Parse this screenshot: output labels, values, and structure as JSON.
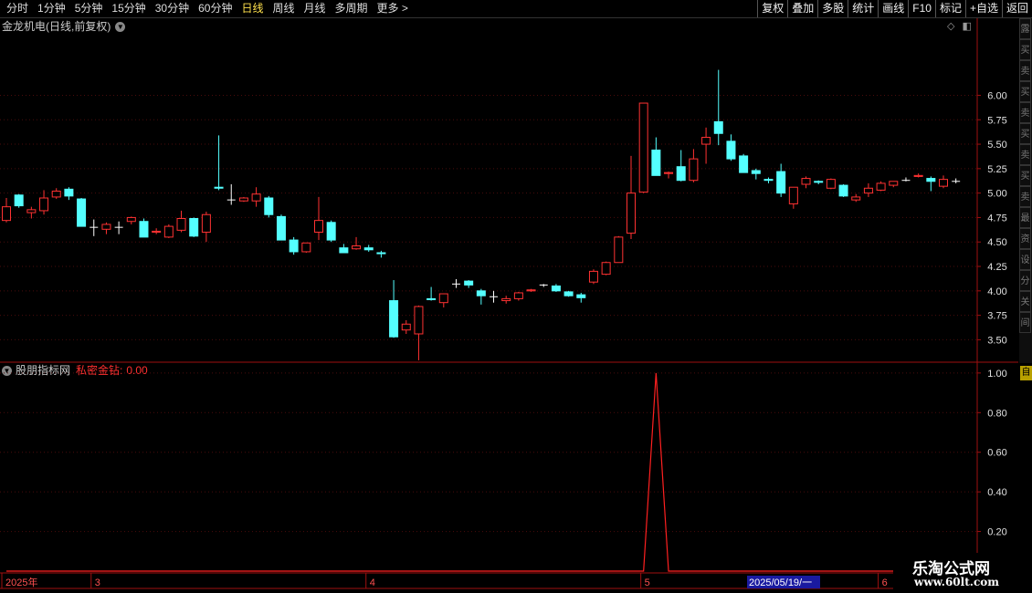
{
  "toolbar": {
    "periods": [
      "分时",
      "1分钟",
      "5分钟",
      "15分钟",
      "30分钟",
      "60分钟",
      "日线",
      "周线",
      "月线",
      "多周期",
      "更多 >"
    ],
    "active_period": "日线",
    "actions": [
      "复权",
      "叠加",
      "多股",
      "统计",
      "画线",
      "F10",
      "标记",
      "+自选",
      "返回"
    ]
  },
  "main_title": "金龙机电(日线,前复权)",
  "indicator": {
    "source": "股朋指标网",
    "name": "私密金钻:",
    "value": "0.00"
  },
  "sidebar_tabs": [
    "露",
    "买",
    "卖",
    "买",
    "卖",
    "买",
    "卖",
    "买",
    "卖",
    "最",
    "资",
    "设",
    "分",
    "关",
    "间"
  ],
  "sidebar_tag": "自",
  "logo": {
    "cn": "乐淘公式网",
    "en": "www.60lt.com"
  },
  "colors": {
    "up": "#ff3232",
    "down": "#54ffff",
    "flat": "#ffffff",
    "indicator_line": "#ff2020",
    "axis": "#a01010",
    "active": "#ffe14d"
  },
  "x_axis": {
    "labels": [
      "2025年",
      "3",
      "4",
      "5",
      "6"
    ],
    "cursor_label": "2025/05/19/一"
  },
  "chart_data": [
    {
      "type": "candlestick",
      "title": "金龙机电(日线,前复权)",
      "ylim": [
        3.28,
        6.62
      ],
      "yticks": [
        3.5,
        3.75,
        4.0,
        4.25,
        4.5,
        4.75,
        5.0,
        5.25,
        5.5,
        5.75,
        6.0
      ],
      "ohlc": [
        [
          4.72,
          4.95,
          4.7,
          4.86
        ],
        [
          4.98,
          4.99,
          4.85,
          4.87
        ],
        [
          4.8,
          4.86,
          4.74,
          4.83
        ],
        [
          4.82,
          5.03,
          4.78,
          4.95
        ],
        [
          4.96,
          5.05,
          4.94,
          5.02
        ],
        [
          5.04,
          5.06,
          4.93,
          4.97
        ],
        [
          4.94,
          4.95,
          4.67,
          4.66
        ],
        [
          4.65,
          4.73,
          4.56,
          4.65
        ],
        [
          4.63,
          4.7,
          4.58,
          4.68
        ],
        [
          4.65,
          4.71,
          4.58,
          4.65
        ],
        [
          4.71,
          4.76,
          4.68,
          4.75
        ],
        [
          4.71,
          4.74,
          4.55,
          4.55
        ],
        [
          4.6,
          4.64,
          4.58,
          4.61
        ],
        [
          4.55,
          4.68,
          4.54,
          4.66
        ],
        [
          4.62,
          4.82,
          4.6,
          4.74
        ],
        [
          4.74,
          4.75,
          4.55,
          4.56
        ],
        [
          4.6,
          4.81,
          4.5,
          4.78
        ],
        [
          5.06,
          5.59,
          5.03,
          5.05
        ],
        [
          4.93,
          5.09,
          4.88,
          4.93
        ],
        [
          4.92,
          4.96,
          4.91,
          4.95
        ],
        [
          4.92,
          5.06,
          4.86,
          4.99
        ],
        [
          4.95,
          4.97,
          4.75,
          4.78
        ],
        [
          4.76,
          4.78,
          4.52,
          4.52
        ],
        [
          4.52,
          4.55,
          4.37,
          4.4
        ],
        [
          4.4,
          4.49,
          4.39,
          4.49
        ],
        [
          4.6,
          4.96,
          4.52,
          4.72
        ],
        [
          4.7,
          4.72,
          4.5,
          4.52
        ],
        [
          4.44,
          4.48,
          4.39,
          4.39
        ],
        [
          4.43,
          4.55,
          4.42,
          4.46
        ],
        [
          4.44,
          4.47,
          4.4,
          4.42
        ],
        [
          4.39,
          4.41,
          4.34,
          4.38
        ],
        [
          3.9,
          4.11,
          3.52,
          3.53
        ],
        [
          3.6,
          3.7,
          3.56,
          3.66
        ],
        [
          3.56,
          3.85,
          3.29,
          3.84
        ],
        [
          3.92,
          4.04,
          3.9,
          3.91
        ],
        [
          3.88,
          3.96,
          3.83,
          3.97
        ],
        [
          4.07,
          4.12,
          4.03,
          4.07
        ],
        [
          4.1,
          4.11,
          4.03,
          4.06
        ],
        [
          4.0,
          4.02,
          3.86,
          3.95
        ],
        [
          3.94,
          4.0,
          3.88,
          3.94
        ],
        [
          3.9,
          3.95,
          3.87,
          3.92
        ],
        [
          3.92,
          3.99,
          3.9,
          3.98
        ],
        [
          4.0,
          4.02,
          3.99,
          4.01
        ],
        [
          4.06,
          4.07,
          4.04,
          4.06
        ],
        [
          4.05,
          4.07,
          3.99,
          4.0
        ],
        [
          3.99,
          4.0,
          3.94,
          3.95
        ],
        [
          3.96,
          3.98,
          3.88,
          3.93
        ],
        [
          4.09,
          4.22,
          4.07,
          4.2
        ],
        [
          4.17,
          4.3,
          4.16,
          4.29
        ],
        [
          4.29,
          4.56,
          4.29,
          4.55
        ],
        [
          4.59,
          5.38,
          4.53,
          5.0
        ],
        [
          5.01,
          5.92,
          5.0,
          5.92
        ],
        [
          5.44,
          5.57,
          5.18,
          5.18
        ],
        [
          5.2,
          5.22,
          5.15,
          5.21
        ],
        [
          5.27,
          5.44,
          5.12,
          5.13
        ],
        [
          5.13,
          5.45,
          5.11,
          5.35
        ],
        [
          5.5,
          5.67,
          5.3,
          5.57
        ],
        [
          5.73,
          6.26,
          5.49,
          5.61
        ],
        [
          5.53,
          5.6,
          5.33,
          5.35
        ],
        [
          5.38,
          5.4,
          5.22,
          5.21
        ],
        [
          5.23,
          5.25,
          5.14,
          5.2
        ],
        [
          5.14,
          5.16,
          5.1,
          5.13
        ],
        [
          5.22,
          5.3,
          4.96,
          5.0
        ],
        [
          4.89,
          5.05,
          4.84,
          5.06
        ],
        [
          5.09,
          5.17,
          5.05,
          5.15
        ],
        [
          5.12,
          5.13,
          5.09,
          5.11
        ],
        [
          5.05,
          5.15,
          5.04,
          5.14
        ],
        [
          5.08,
          5.09,
          4.96,
          4.97
        ],
        [
          4.93,
          4.99,
          4.91,
          4.96
        ],
        [
          5.0,
          5.1,
          4.96,
          5.05
        ],
        [
          5.03,
          5.12,
          5.02,
          5.1
        ],
        [
          5.08,
          5.11,
          5.06,
          5.12
        ],
        [
          5.13,
          5.16,
          5.12,
          5.13
        ],
        [
          5.17,
          5.2,
          5.16,
          5.18
        ],
        [
          5.15,
          5.17,
          5.02,
          5.12
        ],
        [
          5.07,
          5.18,
          5.05,
          5.14
        ],
        [
          5.12,
          5.15,
          5.1,
          5.12
        ]
      ]
    },
    {
      "type": "line",
      "title": "私密金钻",
      "ylim": [
        0.0,
        1.05
      ],
      "yticks": [
        0.2,
        0.4,
        0.6,
        0.8,
        1.0
      ],
      "values": [
        0,
        0,
        0,
        0,
        0,
        0,
        0,
        0,
        0,
        0,
        0,
        0,
        0,
        0,
        0,
        0,
        0,
        0,
        0,
        0,
        0,
        0,
        0,
        0,
        0,
        0,
        0,
        0,
        0,
        0,
        0,
        0,
        0,
        0,
        0,
        0,
        0,
        0,
        0,
        0,
        0,
        0,
        0,
        0,
        0,
        0,
        0,
        0,
        0,
        0,
        0,
        0,
        1,
        0,
        0,
        0,
        0,
        0,
        0,
        0,
        0,
        0,
        0,
        0,
        0,
        0,
        0,
        0,
        0,
        0,
        0,
        0,
        0,
        0,
        0,
        0,
        0
      ]
    }
  ]
}
